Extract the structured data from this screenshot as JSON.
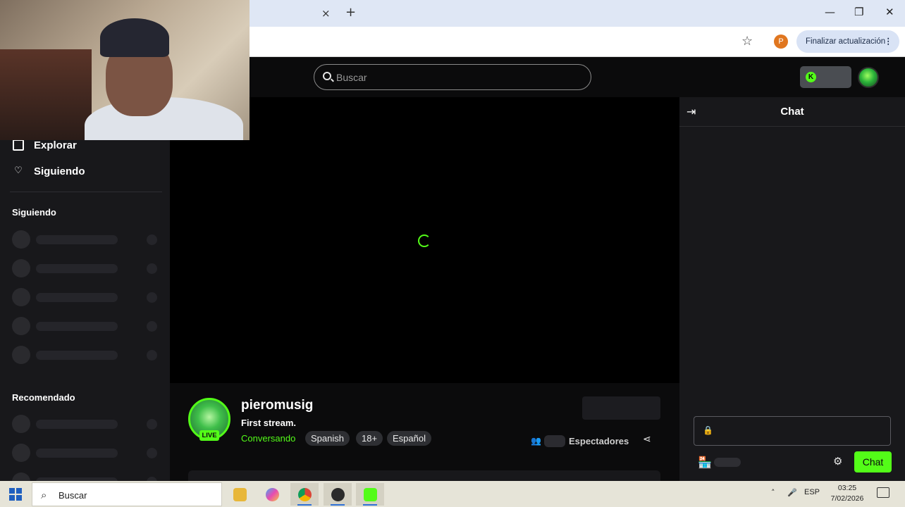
{
  "browser": {
    "tab_close": "×",
    "tab_new": "+",
    "profile_initial": "P",
    "update_button": "Finalizar actualización",
    "window_controls": {
      "minimize": "—",
      "restore": "❐",
      "close": "✕"
    }
  },
  "header": {
    "search_placeholder": "Buscar"
  },
  "sidebar": {
    "nav": [
      {
        "label": "Explorar",
        "icon": "explore-icon"
      },
      {
        "label": "Siguiendo",
        "icon": "heart-icon"
      }
    ],
    "following_title": "Siguiendo",
    "recommended_title": "Recomendado"
  },
  "stream": {
    "streamer": "pieromusig",
    "title": "First stream.",
    "category": "Conversando",
    "live_badge": "LIVE",
    "tags": [
      "Spanish",
      "18+",
      "Español"
    ],
    "viewers_label": "Espectadores"
  },
  "chat": {
    "title": "Chat",
    "send_label": "Chat"
  },
  "taskbar": {
    "search_text": "Buscar",
    "language": "ESP",
    "time": "03:25",
    "date": "7/02/2026"
  },
  "colors": {
    "accent": "#53fc18",
    "background": "#0b0b0c",
    "panel": "#18181b"
  }
}
